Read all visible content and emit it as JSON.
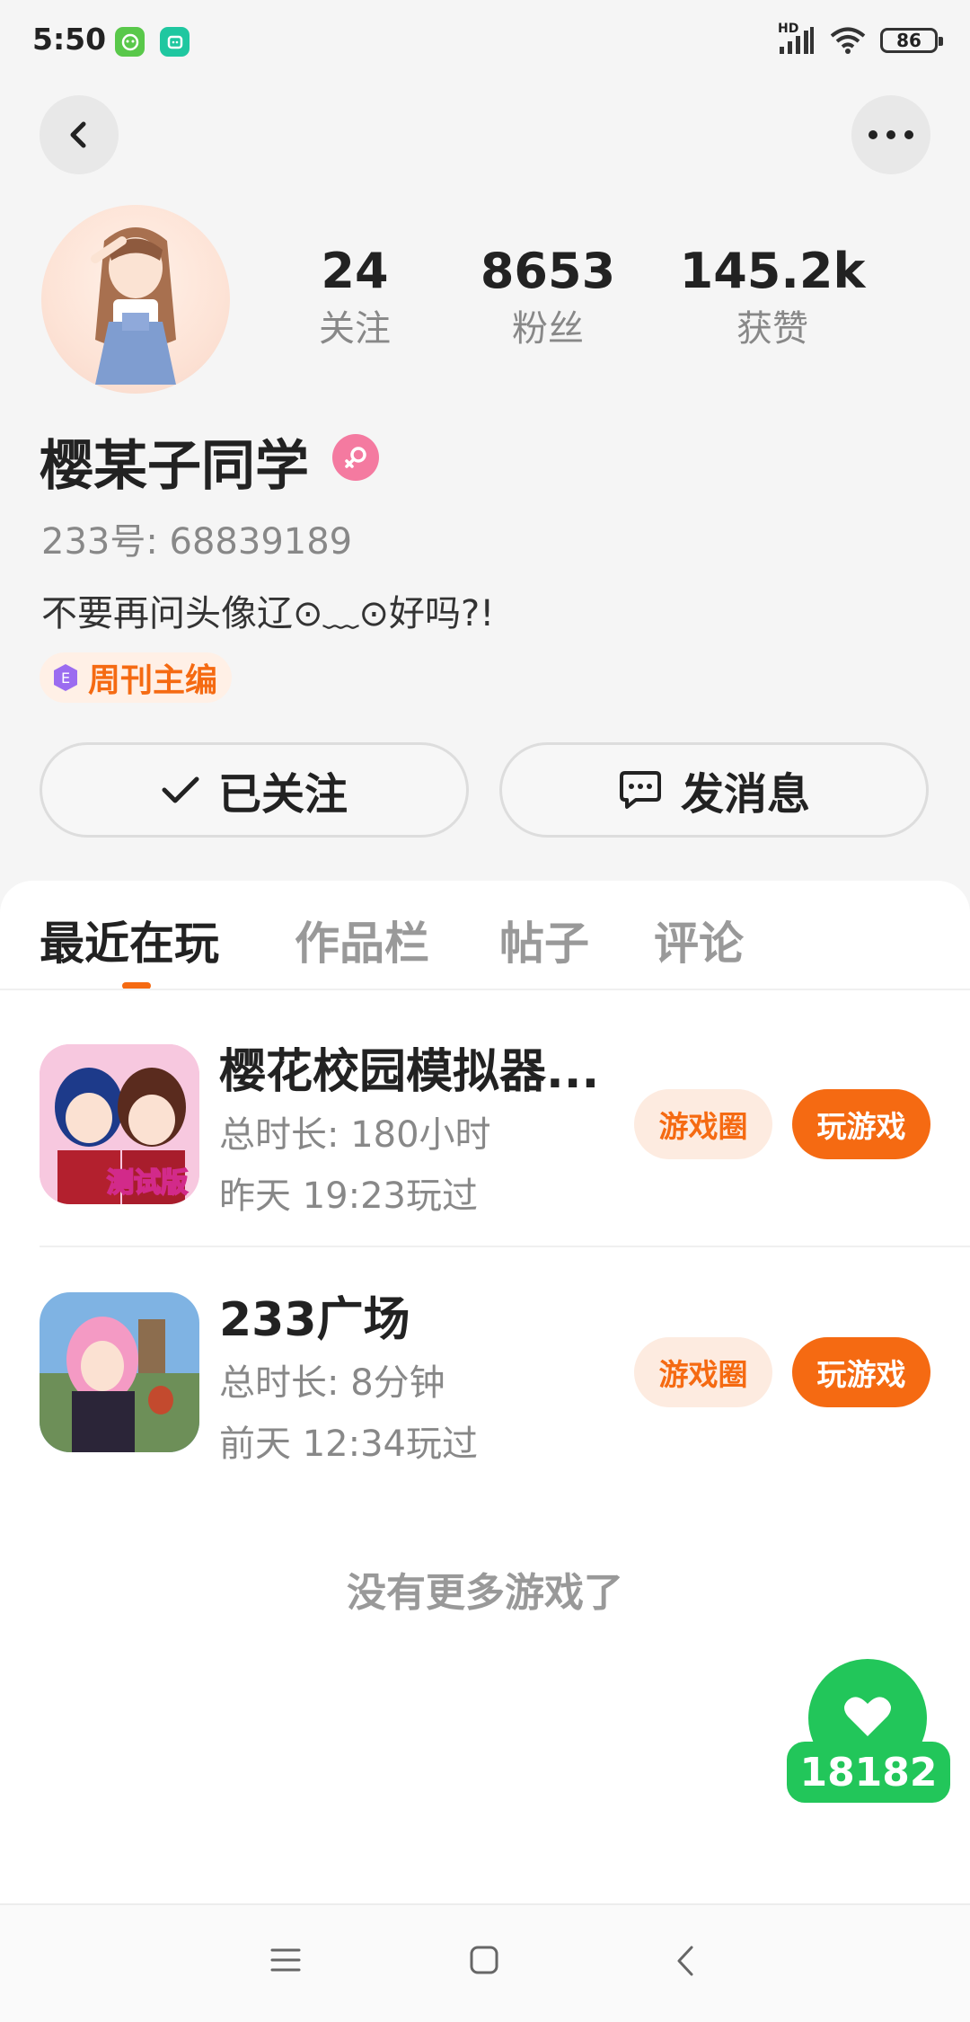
{
  "status_bar": {
    "time": "5:50",
    "network": "HD",
    "battery": "86",
    "icons": [
      "app-icon-green",
      "app-icon-teal",
      "signal-icon",
      "wifi-icon",
      "battery-icon"
    ]
  },
  "header": {
    "icons": [
      "back-icon",
      "more-icon"
    ]
  },
  "profile": {
    "stats": [
      {
        "value": "24",
        "label": "关注"
      },
      {
        "value": "8653",
        "label": "粉丝"
      },
      {
        "value": "145.2k",
        "label": "获赞"
      }
    ],
    "name": "樱某子同学",
    "gender_icon": "female-icon",
    "user_id": "233号: 68839189",
    "bio": "不要再问头像辽⊙﹏⊙好吗?!",
    "badge": "周刊主编",
    "follow_button": "已关注",
    "message_button": "发消息"
  },
  "tabs": [
    "最近在玩",
    "作品栏",
    "帖子",
    "评论"
  ],
  "active_tab": "最近在玩",
  "games": [
    {
      "title": "樱花校园模拟器...",
      "duration": "总时长: 180小时",
      "last_played": "昨天 19:23玩过",
      "icon_text": "测试版",
      "circle_label": "游戏圈",
      "play_label": "玩游戏"
    },
    {
      "title": "233广场",
      "duration": "总时长: 8分钟",
      "last_played": "前天 12:34玩过",
      "circle_label": "游戏圈",
      "play_label": "玩游戏"
    }
  ],
  "no_more_text": "没有更多游戏了",
  "like_count": "18182",
  "colors": {
    "accent": "#f56a12",
    "like_green": "#22c65a",
    "gender_pink": "#f47aa0"
  },
  "nav_icons": [
    "menu-icon",
    "home-icon",
    "back-nav-icon"
  ]
}
